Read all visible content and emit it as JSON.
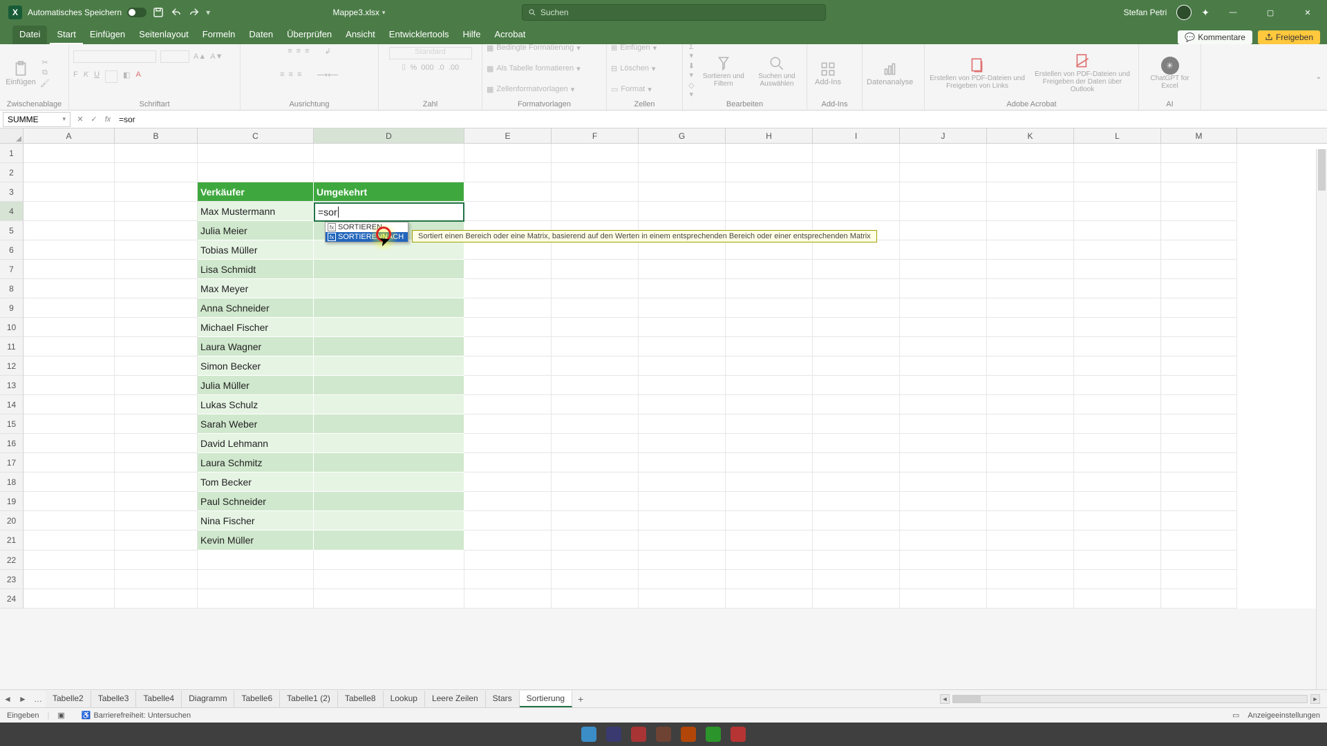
{
  "titlebar": {
    "autosave_label": "Automatisches Speichern",
    "filename": "Mappe3.xlsx",
    "search_placeholder": "Suchen",
    "user": "Stefan Petri"
  },
  "ribbon_tabs": [
    "Datei",
    "Start",
    "Einfügen",
    "Seitenlayout",
    "Formeln",
    "Daten",
    "Überprüfen",
    "Ansicht",
    "Entwicklertools",
    "Hilfe",
    "Acrobat"
  ],
  "active_ribbon_tab": "Start",
  "ribbon_right": {
    "comments": "Kommentare",
    "share": "Freigeben"
  },
  "ribbon_groups": {
    "einfuegen_btn": "Einfügen",
    "zwischenablage": "Zwischenablage",
    "schriftart": "Schriftart",
    "ausrichtung": "Ausrichtung",
    "zahl": "Zahl",
    "zahl_format": "Standard",
    "fv": "Formatvorlagen",
    "fv_items": [
      "Bedingte Formatierung",
      "Als Tabelle formatieren",
      "Zellenformatvorlagen"
    ],
    "zellen": "Zellen",
    "zellen_items": [
      "Einfügen",
      "Löschen",
      "Format"
    ],
    "bearbeiten": "Bearbeiten",
    "bearb_sort": "Sortieren und Filtern",
    "bearb_find": "Suchen und Auswählen",
    "addins": "Add-Ins",
    "addins_btn": "Add-Ins",
    "daten": "Datenanalyse",
    "acrobat": "Adobe Acrobat",
    "acrobat_a": "Erstellen von PDF-Dateien und Freigeben von Links",
    "acrobat_b": "Erstellen von PDF-Dateien und Freigeben der Daten über Outlook",
    "ai": "AI",
    "ai_btn": "ChatGPT for Excel"
  },
  "namebox": "SUMME",
  "formula": "=sor",
  "columns": [
    "A",
    "B",
    "C",
    "D",
    "E",
    "F",
    "G",
    "H",
    "I",
    "J",
    "K",
    "L",
    "M"
  ],
  "active_col": "D",
  "active_row": 4,
  "table": {
    "head_c": "Verkäufer",
    "head_d": "Umgekehrt",
    "rows": [
      "Max Mustermann",
      "Julia Meier",
      "Tobias Müller",
      "Lisa Schmidt",
      "Max Meyer",
      "Anna Schneider",
      "Michael Fischer",
      "Laura Wagner",
      "Simon Becker",
      "Julia Müller",
      "Lukas Schulz",
      "Sarah Weber",
      "David Lehmann",
      "Laura Schmitz",
      "Tom Becker",
      "Paul Schneider",
      "Nina Fischer",
      "Kevin Müller"
    ]
  },
  "active_cell_text": "=sor",
  "autocomplete": {
    "items": [
      "SORTIEREN",
      "SORTIERENNACH"
    ],
    "selected": 1,
    "tooltip": "Sortiert einen Bereich oder eine Matrix, basierend auf den Werten in einem entsprechenden Bereich oder einer entsprechenden Matrix"
  },
  "sheet_tabs": [
    "Tabelle2",
    "Tabelle3",
    "Tabelle4",
    "Diagramm",
    "Tabelle6",
    "Tabelle1 (2)",
    "Tabelle8",
    "Lookup",
    "Leere Zeilen",
    "Stars",
    "Sortierung"
  ],
  "active_sheet": "Sortierung",
  "statusbar": {
    "mode": "Eingeben",
    "a11y": "Barrierefreiheit: Untersuchen",
    "display": "Anzeigeeinstellungen"
  }
}
